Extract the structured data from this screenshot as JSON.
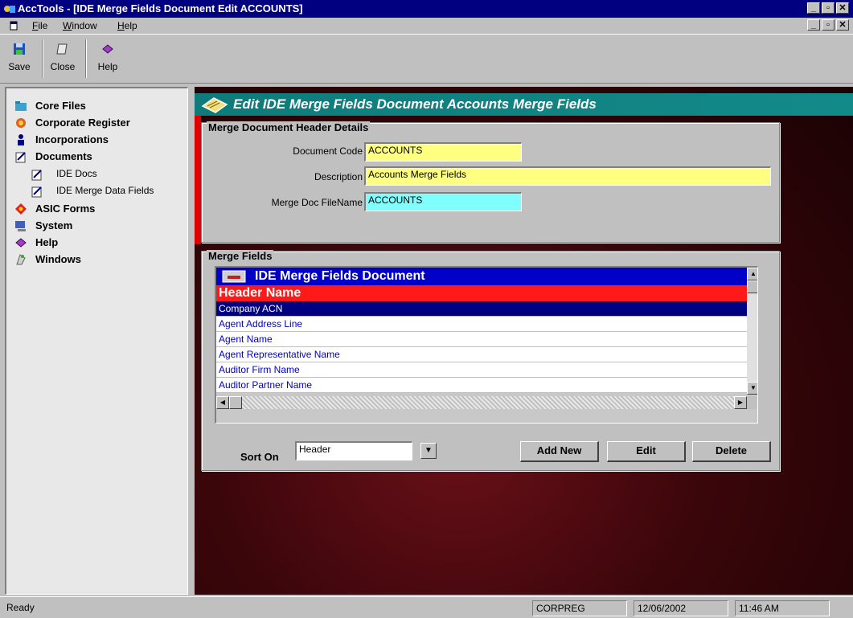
{
  "window": {
    "title": "AccTools - [IDE Merge Fields Document Edit ACCOUNTS]",
    "controls": [
      "_",
      "á",
      "×"
    ]
  },
  "menu": {
    "items": [
      {
        "accel": "F",
        "rest": "ile"
      },
      {
        "accel": "W",
        "rest": "indow"
      },
      {
        "accel": "H",
        "rest": "elp"
      }
    ]
  },
  "toolbar": {
    "buttons": [
      {
        "label": "Save",
        "icon": "save-icon"
      },
      {
        "label": "Close",
        "icon": "close-icon"
      },
      {
        "label": "Help",
        "icon": "help-icon"
      }
    ]
  },
  "sidebar": {
    "items": [
      {
        "label": "Core Files",
        "icon": "folder-icon"
      },
      {
        "label": "Corporate Register",
        "icon": "register-icon"
      },
      {
        "label": "Incorporations",
        "icon": "person-icon"
      },
      {
        "label": "Documents",
        "icon": "document-icon"
      },
      {
        "label": "IDE Docs",
        "icon": "document-icon"
      },
      {
        "label": "IDE Merge Data Fields",
        "icon": "document-icon"
      },
      {
        "label": "ASIC Forms",
        "icon": "asic-icon"
      },
      {
        "label": "System",
        "icon": "system-icon"
      },
      {
        "label": "Help",
        "icon": "help-icon"
      },
      {
        "label": "Windows",
        "icon": "windows-icon"
      }
    ]
  },
  "form": {
    "heading": "Edit IDE Merge Fields Document Accounts Merge Fields",
    "header_group": {
      "title": "Merge Document Header Details",
      "document_code_label": "Document Code",
      "document_code_value": "ACCOUNTS",
      "description_label": "Description",
      "description_value": "Accounts Merge Fields",
      "filename_label": "Merge Doc FileName",
      "filename_value": "ACCOUNTS"
    },
    "fields_group": {
      "title": "Merge Fields",
      "grid_caption": "IDE Merge Fields Document",
      "column_header": "Header Name",
      "rows": [
        "Company ACN",
        "Agent Address Line",
        "Agent Name",
        "Agent Representative Name",
        "Auditor Firm Name",
        "Auditor Partner Name"
      ],
      "selected_row": 0,
      "sort_label": "Sort On",
      "sort_value": "Header",
      "add_new": "Add New",
      "edit": "Edit",
      "delete": "Delete"
    }
  },
  "status": {
    "message": "Ready",
    "database": "CORPREG",
    "date": "12/06/2002",
    "time": "11:46 AM"
  },
  "colors": {
    "title_bar": "#000080",
    "heading_band": "#0f7b7b",
    "grid_caption": "#0000c8",
    "column_header": "#ff1a1a",
    "highlight_field": "#ffff80",
    "filename_field": "#80ffff"
  }
}
